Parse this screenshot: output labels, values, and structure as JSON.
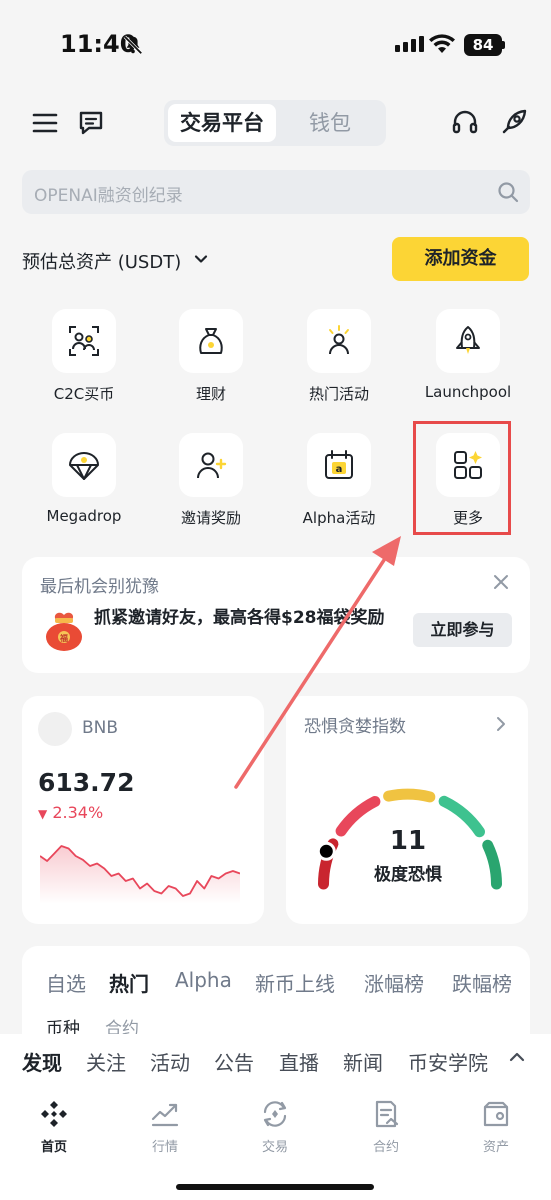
{
  "status_bar": {
    "time": "11:40",
    "battery": "84"
  },
  "header": {
    "tab_exchange": "交易平台",
    "tab_wallet": "钱包"
  },
  "search": {
    "placeholder": "OPENAI融资创纪录"
  },
  "assets": {
    "label": "预估总资产 (USDT)",
    "add_funds": "添加资金"
  },
  "quick_actions": [
    {
      "label": "C2C买币",
      "icon": "c2c-icon"
    },
    {
      "label": "理财",
      "icon": "earn-bag-icon"
    },
    {
      "label": "热门活动",
      "icon": "hot-activity-icon"
    },
    {
      "label": "Launchpool",
      "icon": "rocket-icon"
    },
    {
      "label": "Megadrop",
      "icon": "megadrop-icon"
    },
    {
      "label": "邀请奖励",
      "icon": "invite-user-icon"
    },
    {
      "label": "Alpha活动",
      "icon": "alpha-calendar-icon"
    },
    {
      "label": "更多",
      "icon": "more-grid-icon"
    }
  ],
  "promo": {
    "title": "最后机会别犹豫",
    "body": "抓紧邀请好友，最高各得$28福袋奖励",
    "button": "立即参与"
  },
  "bnb": {
    "name": "BNB",
    "price": "613.72",
    "change": "2.34%",
    "trend": [
      38,
      34,
      40,
      46,
      44,
      38,
      35,
      30,
      32,
      28,
      22,
      24,
      18,
      20,
      12,
      16,
      10,
      8,
      14,
      12,
      6,
      8,
      18,
      12,
      22,
      20,
      24,
      26,
      24
    ]
  },
  "fear_greed": {
    "title": "恐惧贪婪指数",
    "value": "11",
    "label": "极度恐惧",
    "score": 11
  },
  "market_tabs": [
    "自选",
    "热门",
    "Alpha",
    "新币上线",
    "涨幅榜",
    "跌幅榜"
  ],
  "market_subtabs": [
    "币种",
    "合约"
  ],
  "discover_tabs": [
    "发现",
    "关注",
    "活动",
    "公告",
    "直播",
    "新闻",
    "币安学院"
  ],
  "bottom_nav": [
    {
      "label": "首页",
      "icon": "home-icon"
    },
    {
      "label": "行情",
      "icon": "markets-icon"
    },
    {
      "label": "交易",
      "icon": "trade-icon"
    },
    {
      "label": "合约",
      "icon": "futures-icon"
    },
    {
      "label": "资产",
      "icon": "wallet-icon"
    }
  ],
  "colors": {
    "accent": "#fcd535",
    "down": "#e8475b",
    "highlight": "#e74a4a"
  }
}
